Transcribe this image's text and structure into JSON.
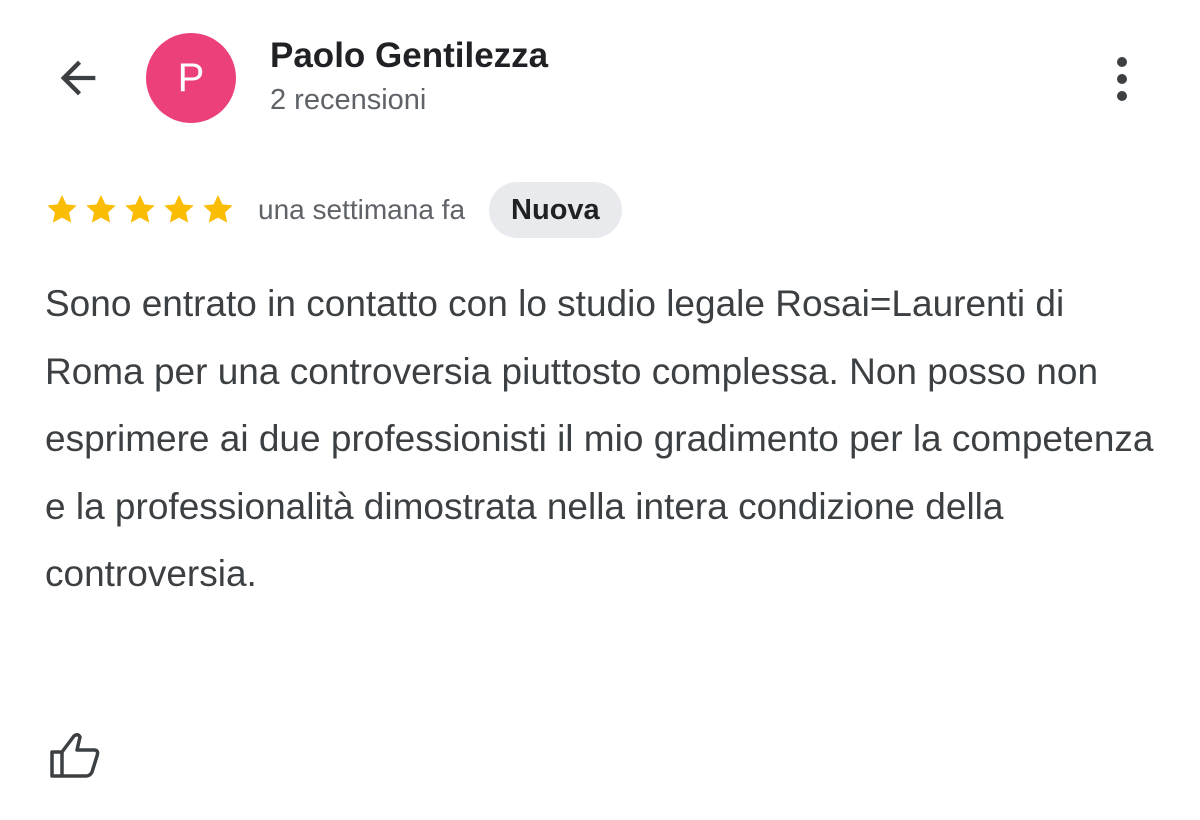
{
  "header": {
    "back_icon": "arrow-back-icon",
    "avatar_letter": "P",
    "avatar_color": "#ec407a",
    "author_name": "Paolo Gentilezza",
    "review_count": "2 recensioni",
    "more_icon": "more-vert-icon"
  },
  "review": {
    "rating": 5,
    "rating_max": 5,
    "star_color": "#fbbc04",
    "time": "una settimana fa",
    "badge": "Nuova",
    "text": "Sono entrato in contatto con lo studio legale Rosai=Laurenti di Roma per una controversia piuttosto complessa. Non posso non esprimere ai due professionisti il mio gradimento per la competenza e la professionalità dimostrata nella intera condizione della controversia."
  },
  "actions": {
    "like_icon": "thumb-up-outline-icon"
  }
}
